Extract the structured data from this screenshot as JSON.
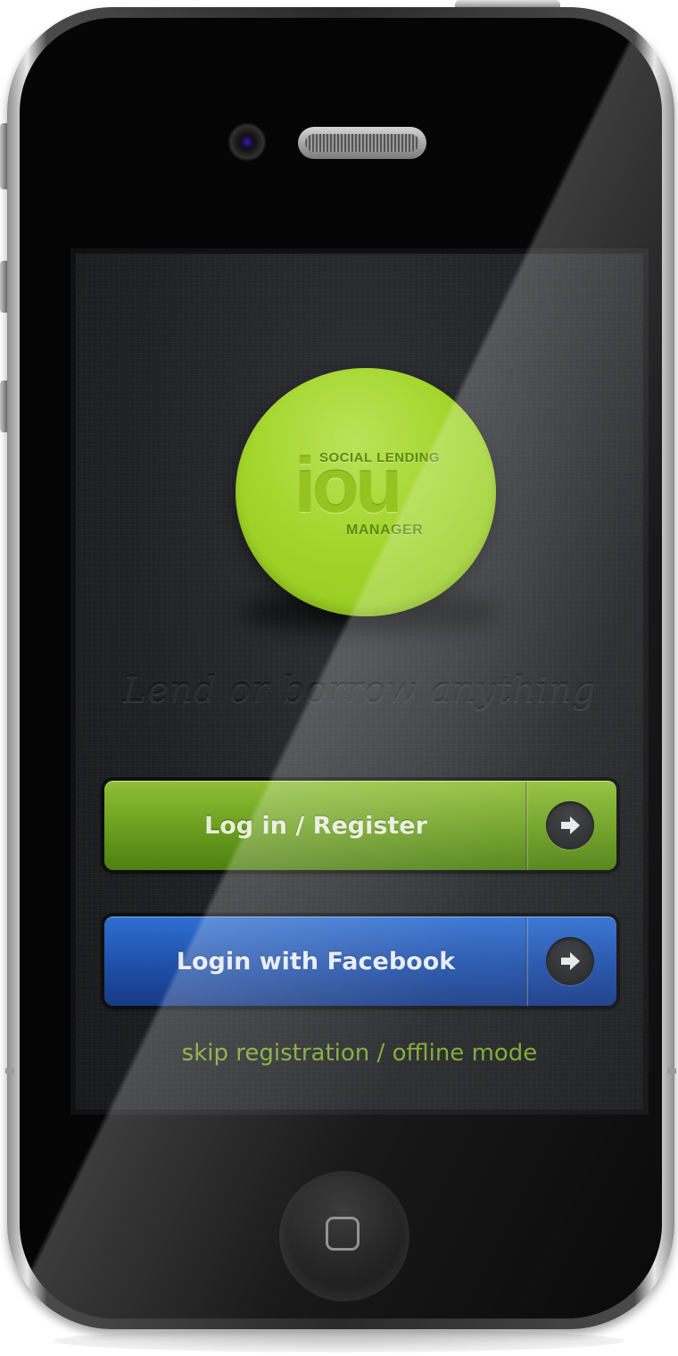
{
  "logo": {
    "top_text": "SOCIAL LENDING",
    "main_text": "iou",
    "bottom_text": "MANAGER"
  },
  "tagline": "Lend or borrow anything",
  "buttons": {
    "login_register": "Log in / Register",
    "facebook": "Login with Facebook"
  },
  "skip_link": "skip registration / offline mode",
  "colors": {
    "accent_green": "#8fc61a",
    "facebook_blue": "#1f4fa8",
    "link_green": "#7aa62a"
  },
  "icons": {
    "button_arrow": "arrow-right-icon",
    "home": "home-square-icon"
  }
}
